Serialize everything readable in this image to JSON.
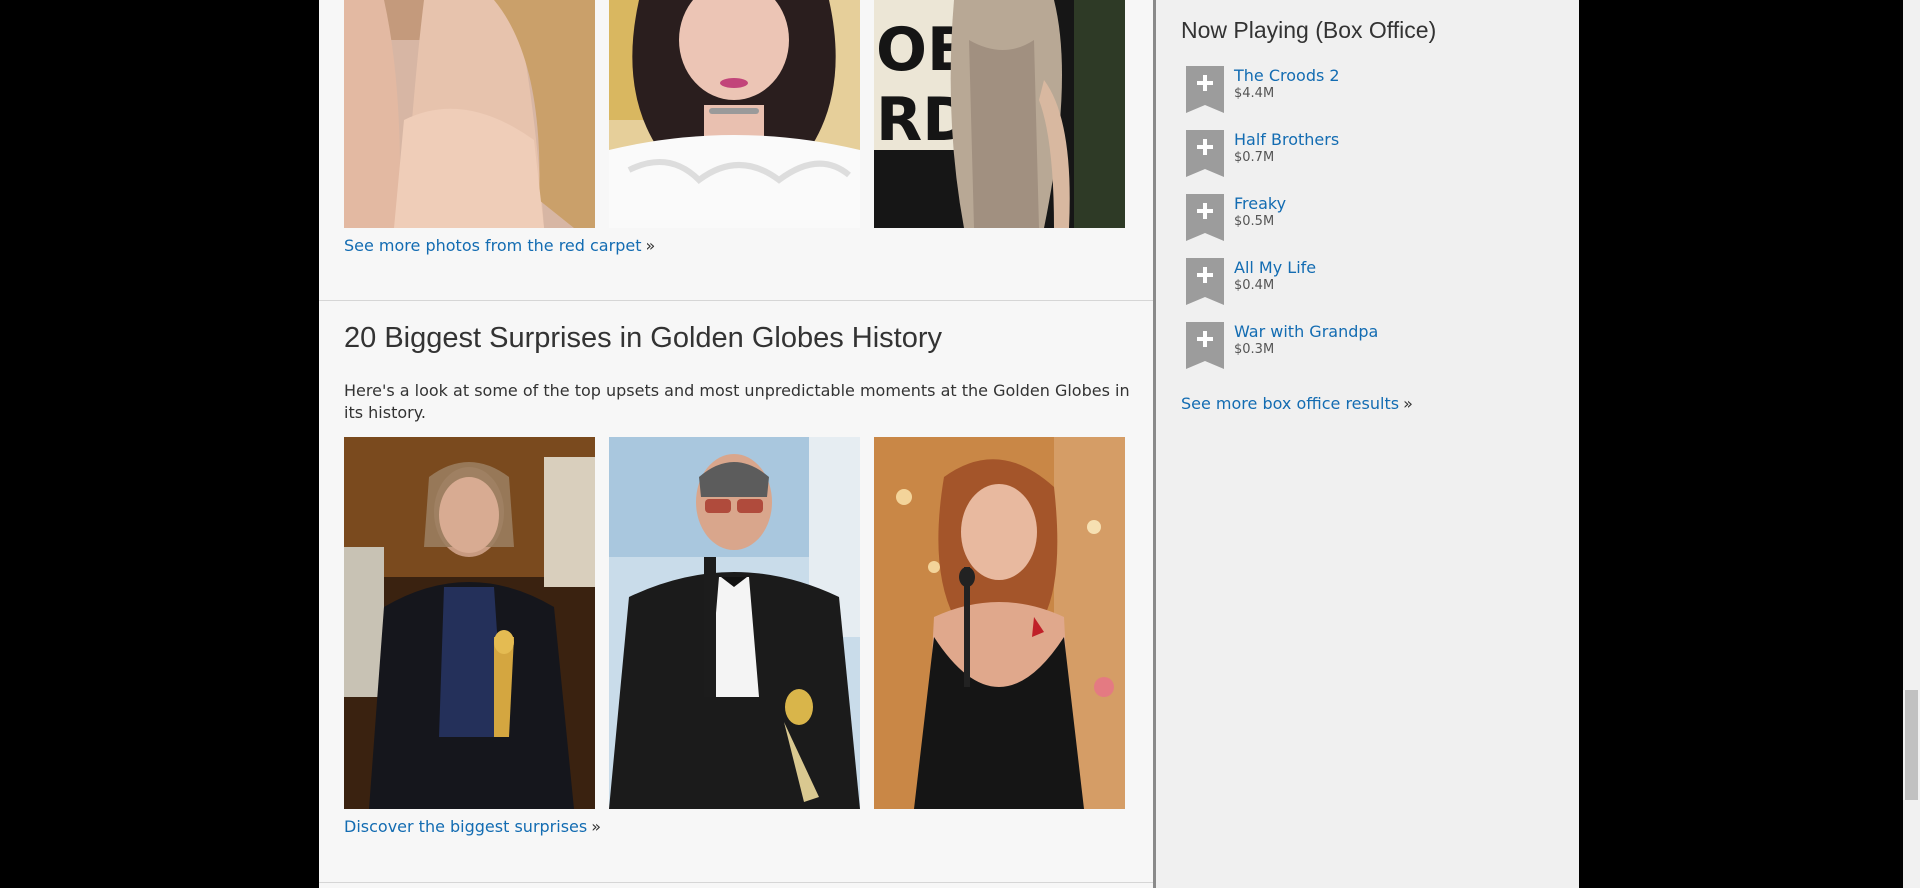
{
  "top_section": {
    "more_link": "See more photos from the red carpet",
    "raquo": "»"
  },
  "surprises_section": {
    "title": "20 Biggest Surprises in Golden Globes History",
    "description": "Here's a look at some of the top upsets and most unpredictable moments at the Golden Globes in its history.",
    "more_link": "Discover the biggest surprises",
    "raquo": "»"
  },
  "sidebar": {
    "title": "Now Playing (Box Office)",
    "items": [
      {
        "title": "The Croods 2",
        "gross": "$4.4M"
      },
      {
        "title": "Half Brothers",
        "gross": "$0.7M"
      },
      {
        "title": "Freaky",
        "gross": "$0.5M"
      },
      {
        "title": "All My Life",
        "gross": "$0.4M"
      },
      {
        "title": "War with Grandpa",
        "gross": "$0.3M"
      }
    ],
    "more_link": "See more box office results",
    "raquo": "»"
  },
  "icons": {
    "watchlist_ribbon": "add-to-watchlist-ribbon-icon"
  },
  "colors": {
    "link": "#136cb2",
    "page_background": "#000000",
    "content_background": "#f7f7f7",
    "sidebar_background": "#f0f0f0"
  }
}
